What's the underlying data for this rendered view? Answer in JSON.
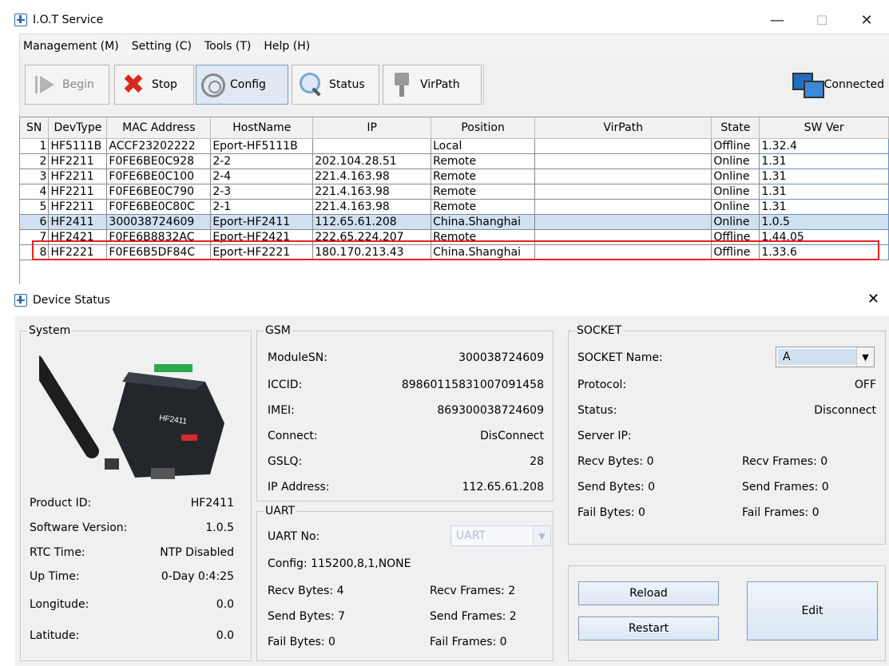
{
  "main_window": {
    "title": "I.O.T Service",
    "controls": {
      "minimize": "—",
      "maximize": "☐",
      "close": "✕"
    }
  },
  "menu": [
    "Management (M)",
    "Setting (C)",
    "Tools (T)",
    "Help (H)"
  ],
  "toolbar": {
    "begin": "Begin",
    "stop": "Stop",
    "config": "Config",
    "status": "Status",
    "virpath": "VirPath",
    "connection": "Connected"
  },
  "device_table": {
    "columns": [
      "SN",
      "DevType",
      "MAC Address",
      "HostName",
      "IP",
      "Position",
      "VirPath",
      "State",
      "SW Ver"
    ],
    "rows": [
      [
        "1",
        "HF5111B",
        "ACCF23202222",
        "Eport-HF5111B",
        "",
        "Local",
        "",
        "Offline",
        "1.32.4"
      ],
      [
        "2",
        "HF2211",
        "F0FE6BE0C928",
        "2-2",
        "202.104.28.51",
        "Remote",
        "",
        "Online",
        "1.31"
      ],
      [
        "3",
        "HF2211",
        "F0FE6BE0C100",
        "2-4",
        "221.4.163.98",
        "Remote",
        "",
        "Online",
        "1.31"
      ],
      [
        "4",
        "HF2211",
        "F0FE6BE0C790",
        "2-3",
        "221.4.163.98",
        "Remote",
        "",
        "Online",
        "1.31"
      ],
      [
        "5",
        "HF2211",
        "F0FE6BE0C80C",
        "2-1",
        "221.4.163.98",
        "Remote",
        "",
        "Online",
        "1.31"
      ],
      [
        "6",
        "HF2411",
        "300038724609",
        "Eport-HF2411",
        "112.65.61.208",
        "China.Shanghai",
        "",
        "Online",
        "1.0.5"
      ],
      [
        "7",
        "HF2421",
        "F0FE6B8832AC",
        "Eport-HF2421",
        "222.65.224.207",
        "Remote",
        "",
        "Offline",
        "1.44.05"
      ],
      [
        "8",
        "HF2221",
        "F0FE6B5DF84C",
        "Eport-HF2221",
        "180.170.213.43",
        "China.Shanghai",
        "",
        "Offline",
        "1.33.6"
      ]
    ],
    "selected_row": 5
  },
  "device_status": {
    "title": "Device Status",
    "close": "✕",
    "system": {
      "legend": "System",
      "product_id_label": "Product ID:",
      "product_id": "HF2411",
      "software_version_label": "Software Version:",
      "software_version": "1.0.5",
      "rtc_time_label": "RTC Time:",
      "rtc_time": "NTP Disabled",
      "up_time_label": "Up Time:",
      "up_time": "0-Day 0:4:25",
      "longitude_label": "Longitude:",
      "longitude": "0.0",
      "latitude_label": "Latitude:",
      "latitude": "0.0",
      "device_image_label": "HF2411"
    },
    "gsm": {
      "legend": "GSM",
      "module_sn_label": "ModuleSN:",
      "module_sn": "300038724609",
      "iccid_label": "ICCID:",
      "iccid": "89860115831007091458",
      "imei_label": "IMEI:",
      "imei": "869300038724609",
      "connect_label": "Connect:",
      "connect": "DisConnect",
      "gslq_label": "GSLQ:",
      "gslq": "28",
      "ip_address_label": "IP Address:",
      "ip_address": "112.65.61.208"
    },
    "uart": {
      "legend": "UART",
      "uart_no_label": "UART No:",
      "uart_no": "UART",
      "config": "Config: 115200,8,1,NONE",
      "recv_bytes": "Recv Bytes: 4",
      "recv_frames": "Recv Frames: 2",
      "send_bytes": "Send Bytes: 7",
      "send_frames": "Send Frames: 2",
      "fail_bytes": "Fail Bytes: 0",
      "fail_frames": "Fail Frames: 0"
    },
    "socket": {
      "legend": "SOCKET",
      "name_label": "SOCKET Name:",
      "name": "A",
      "protocol_label": "Protocol:",
      "protocol": "OFF",
      "status_label": "Status:",
      "status": "Disconnect",
      "server_ip_label": "Server IP:",
      "recv_bytes": "Recv Bytes: 0",
      "recv_frames": "Recv Frames: 0",
      "send_bytes": "Send Bytes: 0",
      "send_frames": "Send Frames: 0",
      "fail_bytes": "Fail Bytes: 0",
      "fail_frames": "Fail Frames: 0"
    },
    "buttons": {
      "reload": "Reload",
      "restart": "Restart",
      "edit": "Edit"
    }
  }
}
